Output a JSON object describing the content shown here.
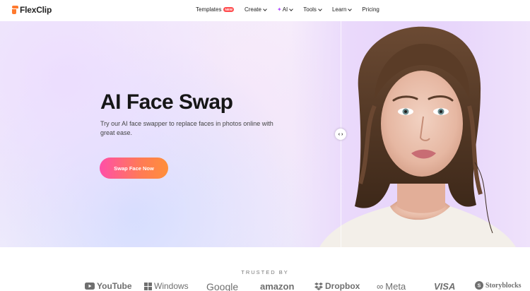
{
  "header": {
    "logo_text": "FlexClip",
    "nav": [
      {
        "label": "Templates",
        "badge": "NEW",
        "has_chevron": false
      },
      {
        "label": "Create",
        "has_chevron": true
      },
      {
        "label": "AI",
        "has_chevron": true,
        "icon": "sparkle-icon"
      },
      {
        "label": "Tools",
        "has_chevron": true
      },
      {
        "label": "Learn",
        "has_chevron": true
      },
      {
        "label": "Pricing",
        "has_chevron": false
      }
    ]
  },
  "hero": {
    "title": "AI Face Swap",
    "description": "Try our AI face swapper to replace faces in photos online with great ease.",
    "cta_label": "Swap Face Now",
    "compare_handle": "‹ ›"
  },
  "trusted": {
    "label": "TRUSTED BY",
    "brands": [
      "YouTube",
      "Windows",
      "Google",
      "amazon",
      "Dropbox",
      "Meta",
      "VISA",
      "Storyblocks"
    ]
  },
  "colors": {
    "accent_start": "#ff4fa8",
    "accent_end": "#ff8f3a",
    "logo_orange": "#ff7a2f",
    "badge_red": "#ff4d4f"
  }
}
